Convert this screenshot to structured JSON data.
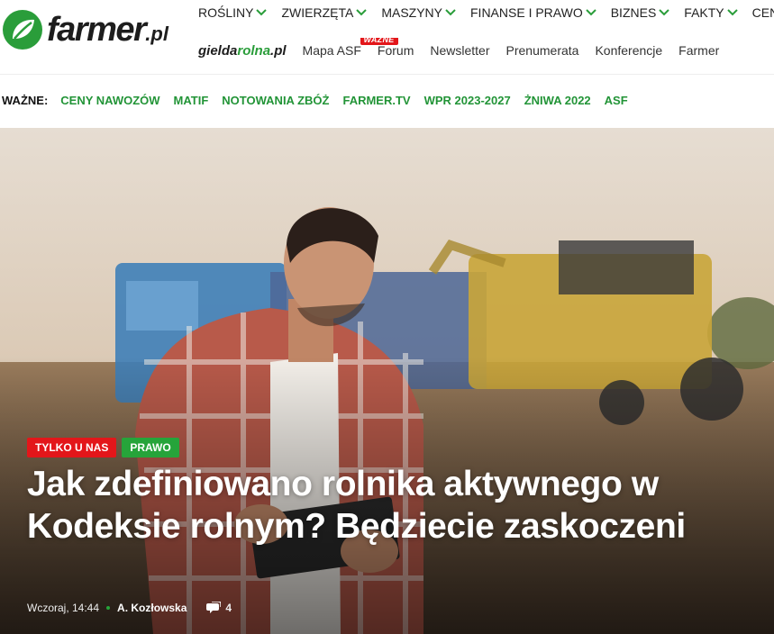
{
  "logo": {
    "name": "farmer",
    "tld": ".pl"
  },
  "topnav": [
    {
      "label": "ROŚLINY"
    },
    {
      "label": "ZWIERZĘTA"
    },
    {
      "label": "MASZYNY"
    },
    {
      "label": "FINANSE I PRAWO"
    },
    {
      "label": "BIZNES"
    },
    {
      "label": "FAKTY"
    },
    {
      "label": "CEN"
    }
  ],
  "subnav": {
    "gielda_main": "gielda",
    "gielda_accent": "rolna",
    "gielda_tld": ".pl",
    "items": [
      {
        "label": "Mapa ASF"
      },
      {
        "label": "Forum"
      },
      {
        "label": "Newsletter"
      },
      {
        "label": "Prenumerata"
      },
      {
        "label": "Konferencje"
      },
      {
        "label": "Farmer"
      }
    ],
    "badge": "WAŻNE"
  },
  "important": {
    "label": "WAŻNE:",
    "links": [
      {
        "label": "CENY NAWOZÓW"
      },
      {
        "label": "MATIF"
      },
      {
        "label": "NOTOWANIA ZBÓŻ"
      },
      {
        "label": "FARMER.TV"
      },
      {
        "label": "WPR 2023-2027"
      },
      {
        "label": "ŻNIWA 2022"
      },
      {
        "label": "ASF"
      }
    ]
  },
  "hero": {
    "tags": [
      {
        "label": "TYLKO U NAS"
      },
      {
        "label": "PRAWO"
      }
    ],
    "headline": "Jak zdefiniowano rolnika aktywnego w Kodeksie rolnym? Będziecie zaskoczeni",
    "date": "Wczoraj, 14:44",
    "author": "A. Kozłowska",
    "comments": "4"
  },
  "colors": {
    "brand_green": "#229437",
    "tag_red": "#e3161a",
    "tag_green": "#26a43a"
  },
  "icons": {
    "logo": "leaf-icon",
    "chevron": "chevron-down-icon",
    "comments": "comment-bubble-icon"
  }
}
